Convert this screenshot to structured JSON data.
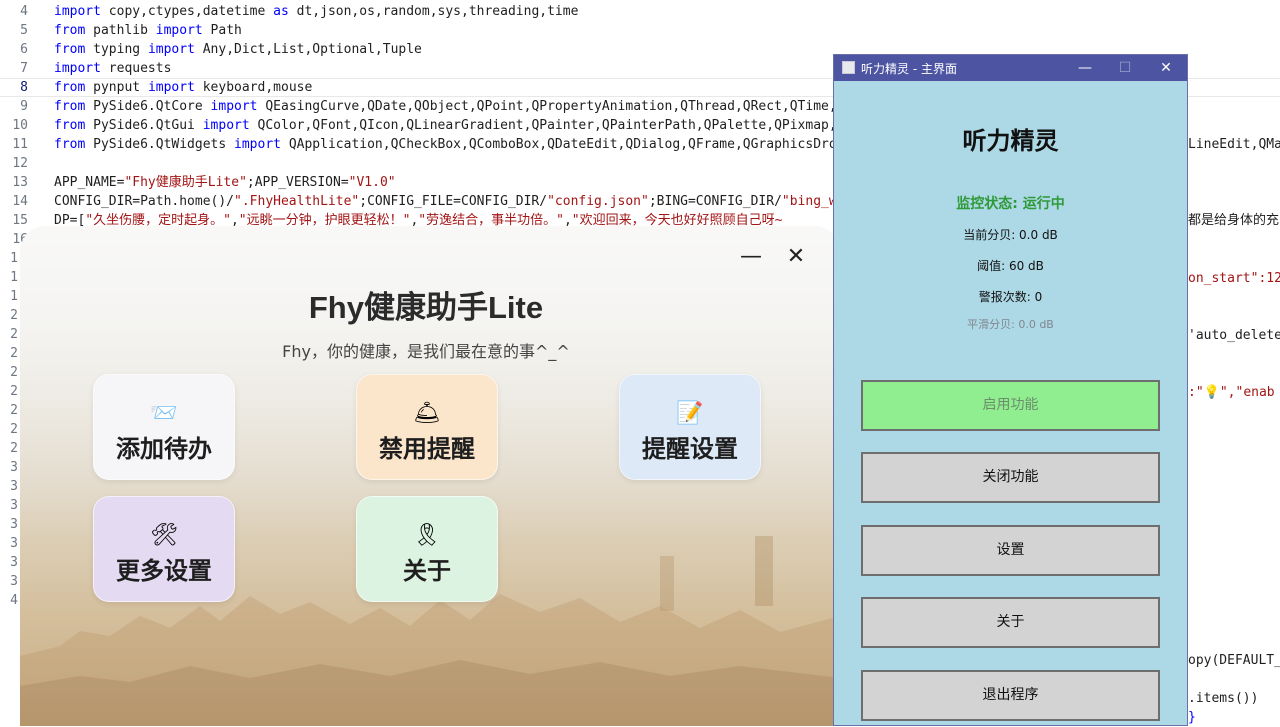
{
  "editor": {
    "lines": [
      {
        "n": "4",
        "segs": [
          [
            "kw",
            "import"
          ],
          [
            "plain",
            " copy,ctypes,datetime "
          ],
          [
            "kw",
            "as"
          ],
          [
            "plain",
            " dt,json,os,random,sys,threading,time"
          ]
        ]
      },
      {
        "n": "5",
        "segs": [
          [
            "kw",
            "from"
          ],
          [
            "plain",
            " pathlib "
          ],
          [
            "kw",
            "import"
          ],
          [
            "plain",
            " Path"
          ]
        ]
      },
      {
        "n": "6",
        "segs": [
          [
            "kw",
            "from"
          ],
          [
            "plain",
            " typing "
          ],
          [
            "kw",
            "import"
          ],
          [
            "plain",
            " Any,Dict,List,Optional,Tuple"
          ]
        ]
      },
      {
        "n": "7",
        "segs": [
          [
            "kw",
            "import"
          ],
          [
            "plain",
            " requests"
          ]
        ]
      },
      {
        "n": "8",
        "segs": [
          [
            "kw",
            "from"
          ],
          [
            "plain",
            " pynput "
          ],
          [
            "kw",
            "import"
          ],
          [
            "plain",
            " keyboard,mouse"
          ]
        ]
      },
      {
        "n": "9",
        "segs": [
          [
            "kw",
            "from"
          ],
          [
            "plain",
            " PySide6.QtCore "
          ],
          [
            "kw",
            "import"
          ],
          [
            "plain",
            " QEasingCurve,QDate,QObject,QPoint,QPropertyAnimation,QThread,QRect,QTime,Q"
          ]
        ]
      },
      {
        "n": "10",
        "segs": [
          [
            "kw",
            "from"
          ],
          [
            "plain",
            " PySide6.QtGui "
          ],
          [
            "kw",
            "import"
          ],
          [
            "plain",
            " QColor,QFont,QIcon,QLinearGradient,QPainter,QPainterPath,QPalette,QPixmap,Q"
          ]
        ]
      },
      {
        "n": "11",
        "segs": [
          [
            "kw",
            "from"
          ],
          [
            "plain",
            " PySide6.QtWidgets "
          ],
          [
            "kw",
            "import"
          ],
          [
            "plain",
            " QApplication,QCheckBox,QComboBox,QDateEdit,QDialog,QFrame,QGraphicsDrop"
          ]
        ]
      },
      {
        "n": "12",
        "segs": []
      },
      {
        "n": "13",
        "segs": [
          [
            "plain",
            "APP_NAME="
          ],
          [
            "str",
            "\"Fhy健康助手Lite\""
          ],
          [
            "plain",
            ";APP_VERSION="
          ],
          [
            "str",
            "\"V1.0\""
          ]
        ]
      },
      {
        "n": "14",
        "segs": [
          [
            "plain",
            "CONFIG_DIR=Path.home()/"
          ],
          [
            "str",
            "\".FhyHealthLite\""
          ],
          [
            "plain",
            ";CONFIG_FILE=CONFIG_DIR/"
          ],
          [
            "str",
            "\"config.json\""
          ],
          [
            "plain",
            ";BING=CONFIG_DIR/"
          ],
          [
            "str",
            "\"bing_wa"
          ]
        ]
      },
      {
        "n": "15",
        "segs": [
          [
            "plain",
            "DP=["
          ],
          [
            "str",
            "\"久坐伤腰，定时起身。\""
          ],
          [
            "plain",
            ","
          ],
          [
            "str",
            "\"远眺一分钟，护眼更轻松！\""
          ],
          [
            "plain",
            ","
          ],
          [
            "str",
            "\"劳逸结合，事半功倍。\""
          ],
          [
            "plain",
            ","
          ],
          [
            "str",
            "\"欢迎回来，今天也好好照顾自己呀~"
          ]
        ]
      },
      {
        "n": "16",
        "segs": []
      }
    ],
    "gutter_rest": [
      "1",
      "1",
      "1",
      "2",
      "2",
      "2",
      "2",
      "2",
      "2",
      "2",
      "2",
      "3",
      "3",
      "3",
      "3",
      "3",
      "3",
      "3",
      "4"
    ],
    "right_fragments": {
      "r11": "LineEdit,QMai",
      "r15": "都是给身体的充",
      "r_on_start": "on_start\":12",
      "r_auto_delete": "'auto_delete'",
      "r_enab": ":\"💡\",\"enab",
      "r_copy": "opy(DEFAULT_",
      "r_items": ".items())",
      "r_brace": "}"
    }
  },
  "fhy": {
    "title": "Fhy健康助手Lite",
    "subtitle": "Fhy，你的健康，是我们最在意的事^_^",
    "minimize_glyph": "—",
    "close_glyph": "✕",
    "tiles": [
      {
        "label": "添加待办",
        "icon": "📨",
        "icon_name": "envelope-icon",
        "bg": "#f6f6f8"
      },
      {
        "label": "禁用提醒",
        "icon": "🛎",
        "icon_name": "bell-icon",
        "bg": "#fbe6cc"
      },
      {
        "label": "提醒设置",
        "icon": "📝",
        "icon_name": "memo-icon",
        "bg": "#dde9f7"
      },
      {
        "label": "更多设置",
        "icon": "🛠",
        "icon_name": "tools-icon",
        "bg": "#e4dbf3"
      },
      {
        "label": "关于",
        "icon": "🎗",
        "icon_name": "ribbon-icon",
        "bg": "#dbf3e0"
      }
    ]
  },
  "tingli": {
    "window_title": "听力精灵 - 主界面",
    "ctrl_min": "—",
    "ctrl_max": "☐",
    "ctrl_close": "✕",
    "heading": "听力精灵",
    "status": "监控状态: 运行中",
    "current_db": "当前分贝: 0.0 dB",
    "threshold": "阈值: 60 dB",
    "alarm_count": "警报次数: 0",
    "smooth_db": "平滑分贝: 0.0 dB",
    "buttons": {
      "enable": "启用功能",
      "disable": "关闭功能",
      "settings": "设置",
      "about": "关于",
      "exit": "退出程序"
    },
    "colors": {
      "window_bg": "#add8e6",
      "enable_bg": "#90ee90",
      "status": "#2e9a38",
      "titlebar": "#4d55a3"
    }
  }
}
